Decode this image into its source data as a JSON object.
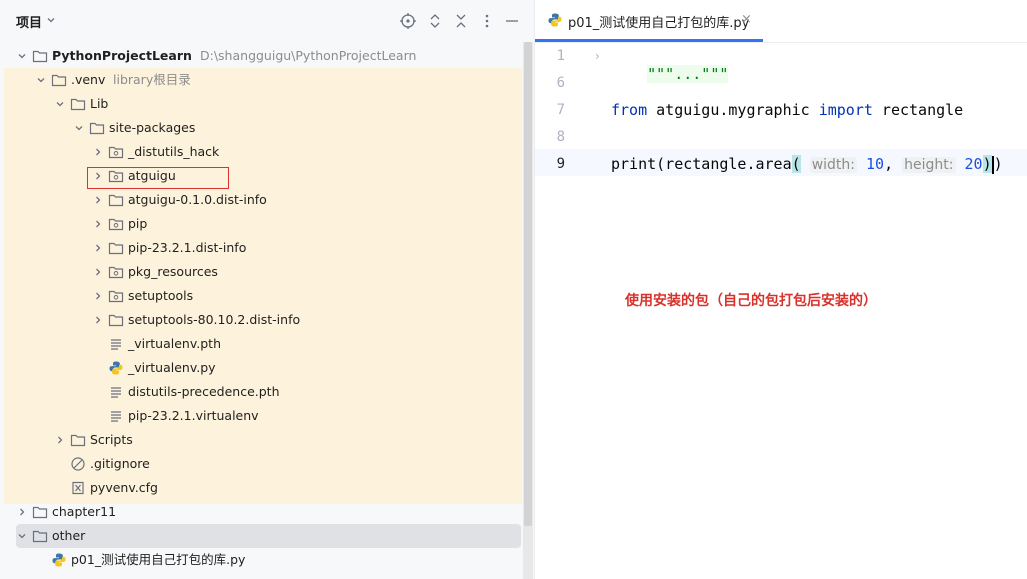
{
  "project_panel": {
    "title": "项目",
    "tree": [
      {
        "label": "PythonProjectLearn",
        "hint": "D:\\shangguigu\\PythonProjectLearn",
        "icon": "folder-icon",
        "expanded": true
      },
      {
        "label": ".venv",
        "hint": "library根目录",
        "icon": "folder-icon",
        "expanded": true
      },
      {
        "label": "Lib",
        "icon": "folder-icon",
        "expanded": true
      },
      {
        "label": "site-packages",
        "icon": "folder-icon",
        "expanded": true
      },
      {
        "label": "_distutils_hack",
        "icon": "package-icon",
        "expanded": false
      },
      {
        "label": "atguigu",
        "icon": "package-icon",
        "expanded": false,
        "highlighted": true
      },
      {
        "label": "atguigu-0.1.0.dist-info",
        "icon": "folder-icon",
        "expanded": false
      },
      {
        "label": "pip",
        "icon": "package-icon",
        "expanded": false
      },
      {
        "label": "pip-23.2.1.dist-info",
        "icon": "folder-icon",
        "expanded": false
      },
      {
        "label": "pkg_resources",
        "icon": "package-icon",
        "expanded": false
      },
      {
        "label": "setuptools",
        "icon": "package-icon",
        "expanded": false
      },
      {
        "label": "setuptools-80.10.2.dist-info",
        "icon": "folder-icon",
        "expanded": false
      },
      {
        "label": "_virtualenv.pth",
        "icon": "text-file-icon"
      },
      {
        "label": "_virtualenv.py",
        "icon": "python-file-icon"
      },
      {
        "label": "distutils-precedence.pth",
        "icon": "text-file-icon"
      },
      {
        "label": "pip-23.2.1.virtualenv",
        "icon": "text-file-icon"
      },
      {
        "label": "Scripts",
        "icon": "folder-icon",
        "expanded": false
      },
      {
        "label": ".gitignore",
        "icon": "ignore-file-icon"
      },
      {
        "label": "pyvenv.cfg",
        "icon": "config-file-icon"
      },
      {
        "label": "chapter11",
        "icon": "folder-icon",
        "expanded": false
      },
      {
        "label": "other",
        "icon": "folder-icon",
        "expanded": true,
        "selected": true
      },
      {
        "label": "p01_测试使用自己打包的库.py",
        "icon": "python-file-icon"
      }
    ]
  },
  "editor": {
    "tab": {
      "label": "p01_测试使用自己打包的库.py",
      "close": "×"
    },
    "lines": [
      {
        "num": "1",
        "text": "\"\"\"...\"\"\""
      },
      {
        "num": "6",
        "text": ""
      },
      {
        "num": "7",
        "kw1": "from",
        "mod": " atguigu.mygraphic ",
        "kw2": "import",
        "name": " rectangle"
      },
      {
        "num": "8",
        "text": ""
      },
      {
        "num": "9",
        "fn": "print(rectangle.area",
        "open": "(",
        "hint1": "width:",
        "val1": "10",
        "sep": ", ",
        "hint2": "height:",
        "val2": "20",
        "close1": ")",
        "close2": ")"
      }
    ],
    "annotation": "使用安装的包（自己的包打包后安装的）"
  },
  "colors": {
    "library_bg": "#fdf3dc",
    "selected_bg": "#dfe1e5",
    "highlight_box": "#d9312b",
    "keyword": "#0033b3",
    "number": "#1750eb",
    "tab_underline": "#3574f0"
  }
}
